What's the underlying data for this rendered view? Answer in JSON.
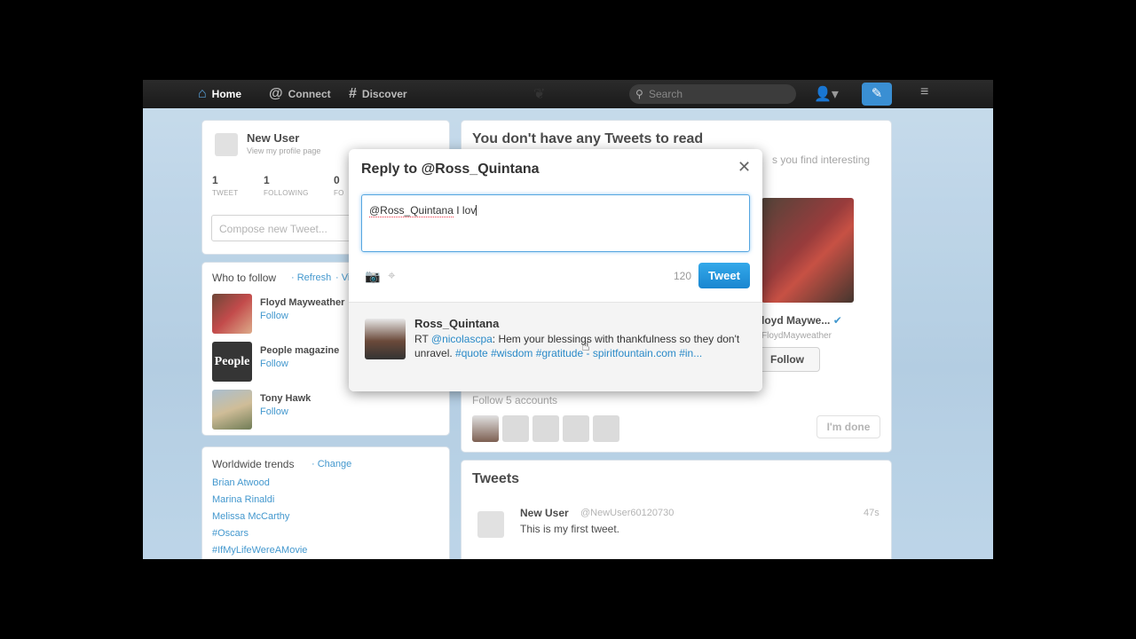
{
  "nav": {
    "home": "Home",
    "connect": "Connect",
    "discover": "Discover",
    "search_placeholder": "Search"
  },
  "profile": {
    "name": "New User",
    "sub": "View my profile page",
    "stats": [
      {
        "value": "1",
        "label": "TWEET"
      },
      {
        "value": "1",
        "label": "FOLLOWING"
      },
      {
        "value": "0",
        "label": "FO"
      }
    ],
    "compose_placeholder": "Compose new Tweet..."
  },
  "who_to_follow": {
    "title": "Who to follow",
    "refresh": "· Refresh",
    "view_all": "· Vie",
    "items": [
      {
        "name": "Floyd Mayweather",
        "follow": "Follow"
      },
      {
        "name": "People magazine",
        "follow": "Follow"
      },
      {
        "name": "Tony Hawk",
        "follow": "Follow"
      }
    ]
  },
  "trends": {
    "title": "Worldwide trends",
    "change": "· Change",
    "items": [
      "Brian Atwood",
      "Marina Rinaldi",
      "Melissa McCarthy",
      "#Oscars",
      "#IfMyLifeWereAMovie"
    ]
  },
  "main": {
    "title": "You don't have any Tweets to read",
    "subtitle": "s you find interesting",
    "feature_name": "loyd Maywe...",
    "feature_handle": "FloydMayweather",
    "feature_follow": "Follow",
    "follow_accounts": "Follow 5 accounts",
    "done": "I'm done"
  },
  "tweets": {
    "title": "Tweets",
    "name": "New User",
    "handle": "@NewUser60120730",
    "time": "47s",
    "text": "This is my first tweet."
  },
  "modal": {
    "title": "Reply to @Ross_Quintana",
    "close": "✕",
    "typed_mention": "@Ross_Quintana",
    "typed_rest": " I lov",
    "char_count": "120",
    "tweet_button": "Tweet",
    "quote_name": "Ross_Quintana",
    "quote_rt": "RT ",
    "quote_mention": "@nicolascpa",
    "quote_body": ": Hem your blessings with thankfulness so they don't unravel. ",
    "quote_tag1": "#quote",
    "quote_tag2": "#wisdom",
    "quote_tag3": "#gratitude",
    "quote_link": " - spiritfountain.com",
    "quote_tag4": "#in..."
  },
  "colors": {
    "accent": "#2a8ac8",
    "tweet_button": "#1a86d0",
    "topbar": "#1f1f1f"
  }
}
